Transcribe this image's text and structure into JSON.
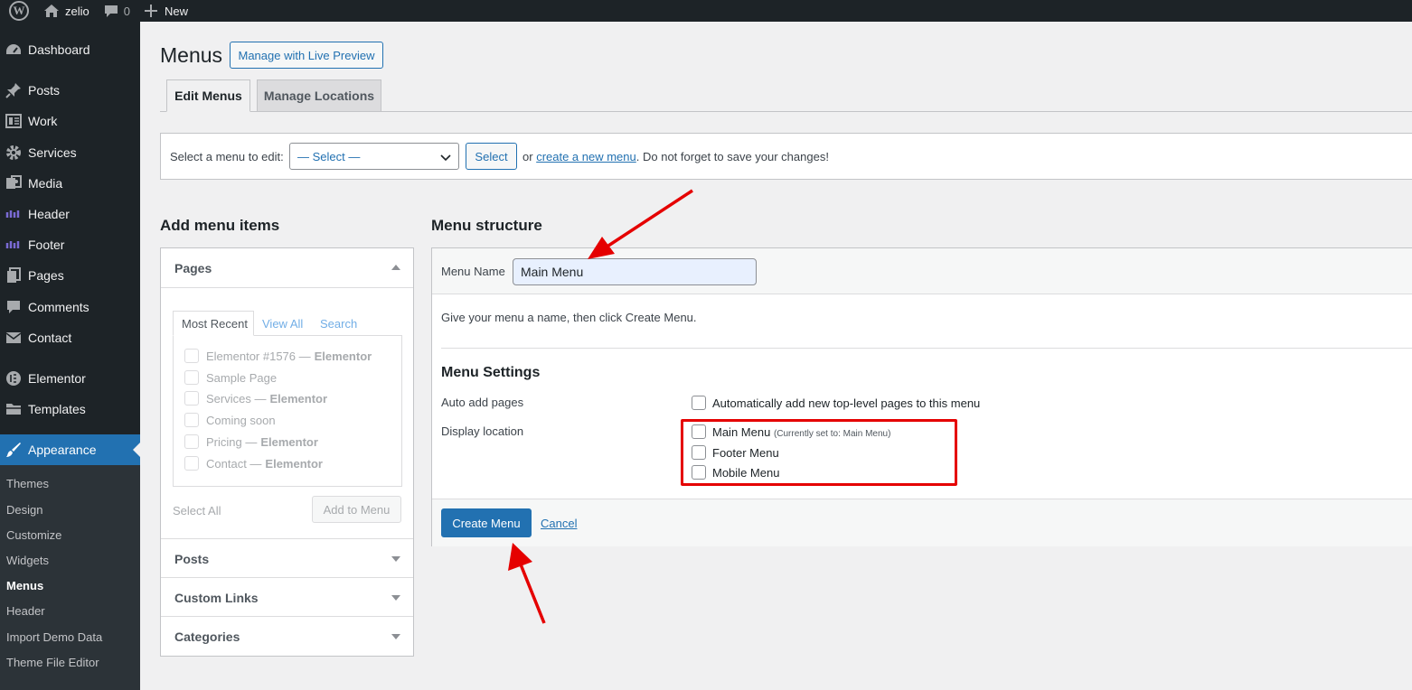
{
  "admin_bar": {
    "site_name": "zelio",
    "comments_count": "0",
    "new_label": "New"
  },
  "sidebar": {
    "items": [
      {
        "label": "Dashboard",
        "icon": "dashboard-icon"
      },
      {
        "label": "Posts",
        "icon": "pin-icon"
      },
      {
        "label": "Work",
        "icon": "portfolio-icon"
      },
      {
        "label": "Services",
        "icon": "gear-icon"
      },
      {
        "label": "Media",
        "icon": "media-icon"
      },
      {
        "label": "Header",
        "icon": "elementor-kit-icon"
      },
      {
        "label": "Footer",
        "icon": "elementor-kit-icon"
      },
      {
        "label": "Pages",
        "icon": "pages-icon"
      },
      {
        "label": "Comments",
        "icon": "comment-icon"
      },
      {
        "label": "Contact",
        "icon": "mail-icon"
      },
      {
        "label": "Elementor",
        "icon": "elementor-icon"
      },
      {
        "label": "Templates",
        "icon": "folder-icon"
      },
      {
        "label": "Appearance",
        "icon": "brush-icon"
      }
    ],
    "submenu": [
      "Themes",
      "Design",
      "Customize",
      "Widgets",
      "Menus",
      "Header",
      "Import Demo Data",
      "Theme File Editor"
    ]
  },
  "header": {
    "title": "Menus",
    "live_preview_button": "Manage with Live Preview",
    "tabs": [
      "Edit Menus",
      "Manage Locations"
    ]
  },
  "select_bar": {
    "label": "Select a menu to edit:",
    "select_value": "— Select —",
    "select_button": "Select",
    "or_text": "or",
    "create_link": "create a new menu",
    "hint": ". Do not forget to save your changes!"
  },
  "add_items": {
    "heading": "Add menu items",
    "pages_title": "Pages",
    "subtabs": [
      "Most Recent",
      "View All",
      "Search"
    ],
    "pages": [
      {
        "name": "Elementor #1576 —",
        "tag": "Elementor"
      },
      {
        "name": "Sample Page",
        "tag": ""
      },
      {
        "name": "Services —",
        "tag": "Elementor"
      },
      {
        "name": "Coming soon",
        "tag": ""
      },
      {
        "name": "Pricing —",
        "tag": "Elementor"
      },
      {
        "name": "Contact —",
        "tag": "Elementor"
      }
    ],
    "select_all": "Select All",
    "add_button": "Add to Menu",
    "sections": [
      "Posts",
      "Custom Links",
      "Categories"
    ]
  },
  "menu_structure": {
    "heading": "Menu structure",
    "name_label": "Menu Name",
    "name_value": "Main Menu",
    "instructions": "Give your menu a name, then click Create Menu.",
    "settings_heading": "Menu Settings",
    "auto_add_label": "Auto add pages",
    "auto_add_option": "Automatically add new top-level pages to this menu",
    "display_location_label": "Display location",
    "locations": [
      {
        "label": "Main Menu",
        "note": "(Currently set to: Main Menu)"
      },
      {
        "label": "Footer Menu",
        "note": ""
      },
      {
        "label": "Mobile Menu",
        "note": ""
      }
    ],
    "create_button": "Create Menu",
    "cancel_link": "Cancel"
  },
  "colors": {
    "accent": "#2271b1",
    "sidebar_bg": "#1d2327",
    "annotation_red": "#e50000"
  }
}
